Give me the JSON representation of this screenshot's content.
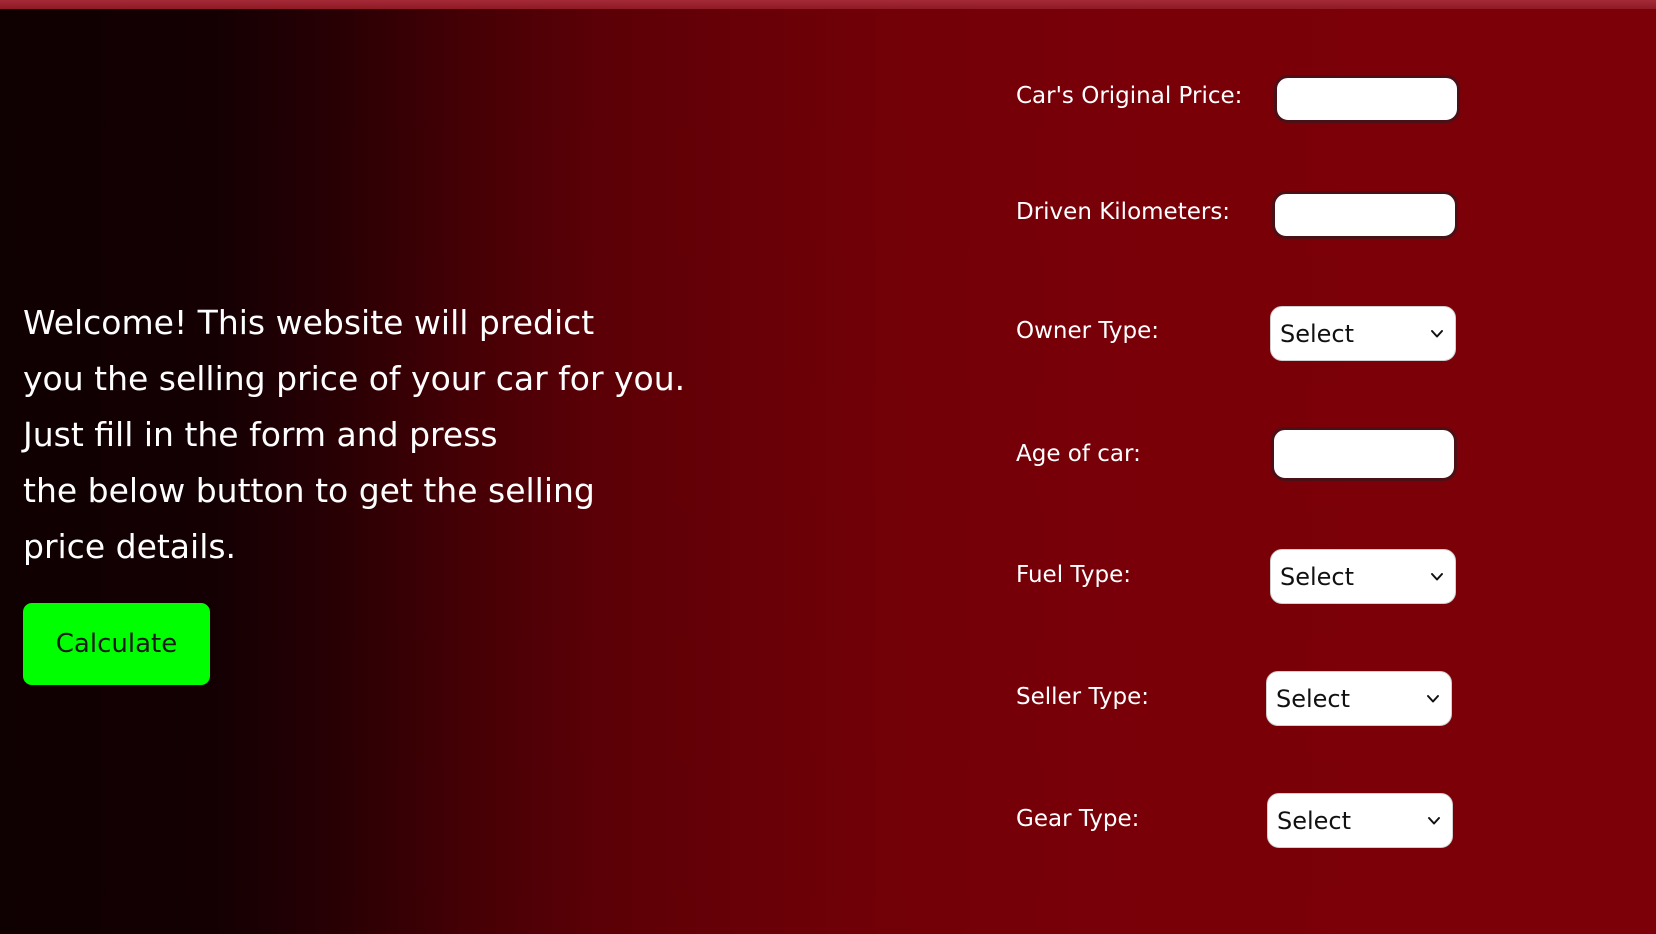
{
  "intro": {
    "lines": [
      "Welcome! This website will predict",
      "you the selling price of your car for you.",
      "Just fill in the form and press",
      "the below button to get the selling",
      "price details."
    ]
  },
  "actions": {
    "calculate_label": "Calculate"
  },
  "form": {
    "original_price": {
      "label": "Car's Original Price:",
      "value": ""
    },
    "driven_km": {
      "label": "Driven Kilometers:",
      "value": ""
    },
    "owner_type": {
      "label": "Owner Type:",
      "selected": "Select"
    },
    "car_age": {
      "label": "Age of car:",
      "value": ""
    },
    "fuel_type": {
      "label": "Fuel Type:",
      "selected": "Select"
    },
    "seller_type": {
      "label": "Seller Type:",
      "selected": "Select"
    },
    "gear_type": {
      "label": "Gear Type:",
      "selected": "Select"
    }
  },
  "icons": {
    "dropdown": "chevron-down-icon"
  },
  "colors": {
    "accent_button": "#00ff00",
    "background_dark": "#0f0002",
    "background_red": "#7c0008",
    "text": "#ffffff"
  }
}
